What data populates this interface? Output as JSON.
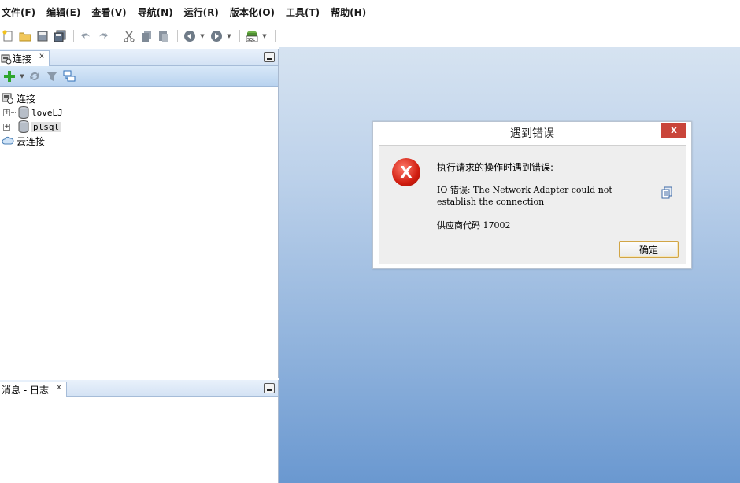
{
  "menu": [
    "文件(F)",
    "编辑(E)",
    "查看(V)",
    "导航(N)",
    "运行(R)",
    "版本化(O)",
    "工具(T)",
    "帮助(H)"
  ],
  "connections_panel": {
    "tab_label": "连接",
    "tab_close": "x",
    "tree": {
      "root": "连接",
      "children": [
        "loveLJ",
        "plsql"
      ],
      "cloud": "云连接"
    }
  },
  "log_panel": {
    "tab_label": "消息 - 日志",
    "tab_close": "x"
  },
  "dialog": {
    "title": "遇到错误",
    "close": "x",
    "icon_glyph": "X",
    "message": "执行请求的操作时遇到错误:",
    "detail": "IO 错误: The Network Adapter could not establish the connection",
    "vendor_code": "供应商代码 17002",
    "ok_label": "确定"
  },
  "colors": {
    "desktop_top": "#d6e3f1",
    "desktop_bottom": "#6a98d0",
    "close_button": "#c9453a",
    "error_red": "#d01d10"
  }
}
